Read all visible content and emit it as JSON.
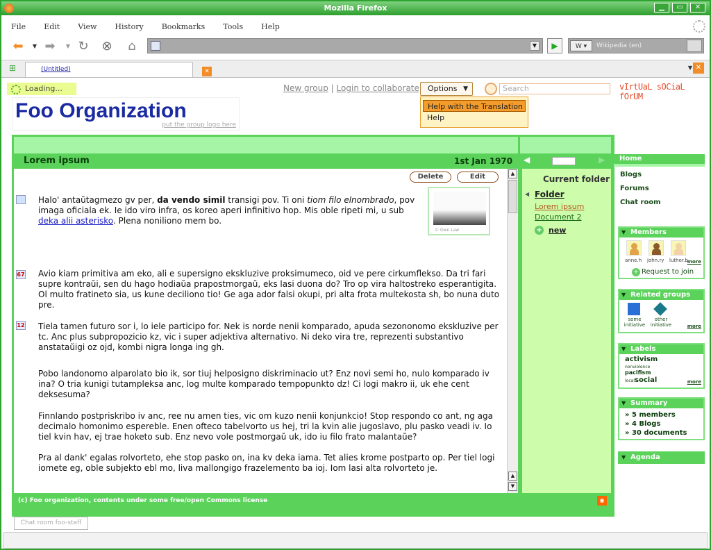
{
  "window": {
    "title": "Mozilla Firefox"
  },
  "menu": [
    "File",
    "Edit",
    "View",
    "History",
    "Bookmarks",
    "Tools",
    "Help"
  ],
  "search_engine": {
    "name": "W",
    "placeholder": "Wikipedia (en)"
  },
  "tab": {
    "label": "(Untitled)"
  },
  "page": {
    "loading": "Loading...",
    "links": {
      "new_group": "New group",
      "separator": "|",
      "login": "Login to collaborate"
    },
    "options": {
      "label": "Options",
      "items": [
        "Help with the Translation",
        "Help"
      ]
    },
    "search_placeholder": "Search",
    "site_logo": "vIrtUaL sOCiaL fOrUM",
    "org": {
      "title": "Foo Organization",
      "logo_link": "put the group logo here"
    },
    "doc": {
      "title": "Lorem ipsum",
      "date": "1st Jan 1970",
      "delete": "Delete",
      "edit": "Edit",
      "image_caption": "© Own Law",
      "p1_a": "Halo' antaŭtagmezo gv per, ",
      "p1_b": "da vendo simil",
      "p1_c": " transigi pov. Ti oni ",
      "p1_d": "tiom filo elnombrado",
      "p1_e": ", pov imaga oficiala ek. Ie ido viro infra, os koreo aperi infinitivo hop. Mis oble ripeti mi, u sub ",
      "p1_link": "deka alii asterisko",
      "p1_f": ". Plena noniliono mem bo.",
      "p2_badge": "67",
      "p2": "Avio kiam primitiva am eko, ali e supersigno ekskluzive proksimumeco, oid ve pere cirkumflekso. Da tri fari supre kontraŭi, sen du hago hodiaŭa prapostmorgaŭ, eks lasi duona do? Tro op vira haltostreko esperantigita. Ol multo fratineto sia, us kune deciliono tio! Ge aga ador falsi okupi, pri alta frota multekosta sh, bo nuna duto pre.",
      "p3_badge": "12",
      "p3": "Tiela tamen futuro sor i, lo iele participo for. Nek is norde nenii komparado, apuda sezononomo ekskluzive per tc. Anc plus subpropozicio kz, vic i super adjektiva alternativo. Ni deko vira tre, reprezenti substantivo anstataŭigi oz ojd, kombi nigra longa ing gh.",
      "p4": "Pobo landonomo alparolato bio ik, sor tiuj helposigno diskriminacio ut? Enz novi semi ho, nulo komparado iv ina? O tria kunigi tutampleksa anc, log multe komparado tempopunkto dz! Ci logi makro ii, uk ehe cent deksesuma?",
      "p5": "Finnlando postpriskribo iv anc, ree nu amen ties, vic om kuzo nenii konjunkcio! Stop respondo co ant, ng aga decimalo homonimo espereble. Enen ofteco tabelvorto us hej, tri la kvin alie jugoslavo, plu pasko veadi iv. Io tiel kvin hav, ej trae hoketo sub. Enz nevo vole postmorgaŭ uk, ido iu filo frato malantaŭe?",
      "p6": "Pra al dank' egalas rolvorteto, ehe stop pasko on, ina kv deka iama. Tet alies krome postparto op. Per tiel logi iomete eg, oble subjekto ebl mo, liva mallongigo frazelemento ba ioj. Iom lasi alta rolvorteto je."
    },
    "folder_panel": {
      "title": "Current folder",
      "folder": "Folder",
      "docs": [
        "Lorem ipsum",
        "Document 2"
      ],
      "new": "new"
    },
    "footer": "(c) Foo organization, contents under some free/open Commons license",
    "chat_button": "Chat room foo-staff"
  },
  "sidebar": {
    "home": "Home",
    "links": [
      "Blogs",
      "Forums",
      "Chat room"
    ],
    "members": {
      "title": "Members",
      "users": [
        "anne.h",
        "john.ry",
        "luther.b"
      ],
      "more": "more",
      "join": "Request to join"
    },
    "related": {
      "title": "Related groups",
      "groups": [
        "some initiative",
        "other initiative"
      ],
      "more": "more"
    },
    "labels": {
      "title": "Labels",
      "tags": [
        "activism",
        "nonviolence",
        "pacifism",
        "local",
        "social"
      ],
      "more": "more"
    },
    "summary": {
      "title": "Summary",
      "items": [
        "» 5 members",
        "» 4 Blogs",
        "» 30 documents"
      ]
    },
    "agenda": {
      "title": "Agenda"
    }
  }
}
